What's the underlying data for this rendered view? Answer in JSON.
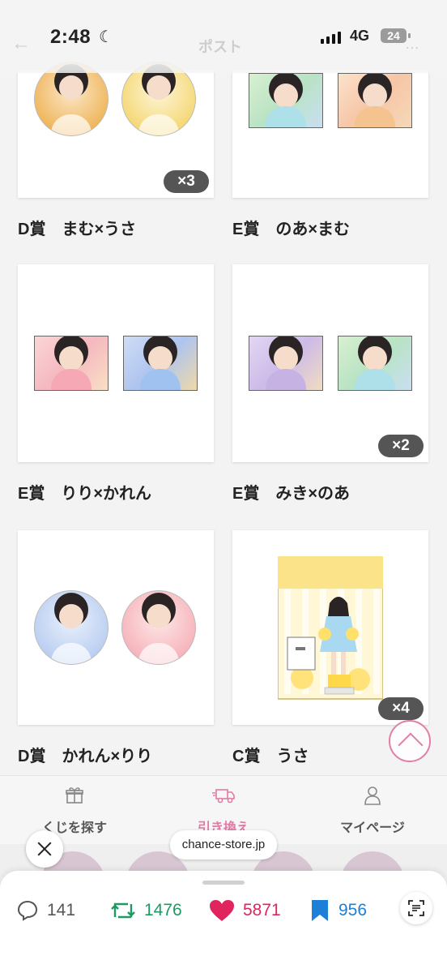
{
  "status": {
    "time": "2:48",
    "network": "4G",
    "battery": "24"
  },
  "header": {
    "back_glyph": "←",
    "title": "ポスト",
    "more_glyph": "…"
  },
  "prizes": [
    {
      "label": "D賞　まむ×うさ",
      "count": "×3"
    },
    {
      "label": "E賞　のあ×まむ",
      "count": ""
    },
    {
      "label": "E賞　りり×かれん",
      "count": ""
    },
    {
      "label": "E賞　みき×のあ",
      "count": "×2"
    },
    {
      "label": "D賞　かれん×りり",
      "count": ""
    },
    {
      "label": "C賞　うさ",
      "count": "×4"
    }
  ],
  "nav": {
    "items": [
      {
        "label": "くじを探す",
        "icon": "gift-icon"
      },
      {
        "label": "引き換え",
        "icon": "truck-icon"
      },
      {
        "label": "マイページ",
        "icon": "person-icon"
      }
    ],
    "active_color": "#e27aa5"
  },
  "url": "chance-store.jp",
  "post_actions": {
    "replies": "141",
    "reposts": "1476",
    "likes": "5871",
    "bookmarks": "956"
  },
  "colors": {
    "repost": "#1d9a62",
    "like": "#e0245e",
    "bookmark": "#1d7fd8",
    "accent_pink": "#e07fa8"
  }
}
